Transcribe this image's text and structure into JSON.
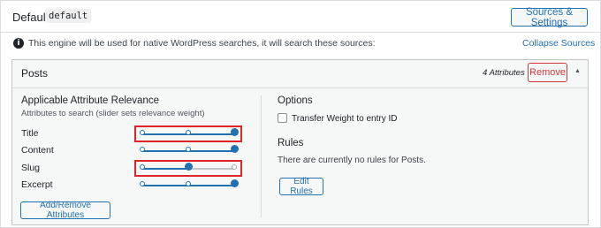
{
  "engine": {
    "title": "Default",
    "slug": "default",
    "sources_button": "Sources & Settings"
  },
  "notice": {
    "icon": "info-icon",
    "icon_glyph": "i",
    "text": "This engine will be used for native WordPress searches, it will search these sources:",
    "collapse_link": "Collapse Sources"
  },
  "source": {
    "title": "Posts",
    "attribute_count": "4 Attributes",
    "remove_button": "Remove",
    "caret_glyph": "▲",
    "left": {
      "heading": "Applicable Attribute Relevance",
      "subheading": "Attributes to search (slider sets relevance weight)",
      "attributes": [
        {
          "label": "Title",
          "weight": 1.0
        },
        {
          "label": "Content",
          "weight": 1.0
        },
        {
          "label": "Slug",
          "weight": 0.5
        },
        {
          "label": "Excerpt",
          "weight": 1.0
        }
      ],
      "add_remove_button": "Add/Remove Attributes"
    },
    "right": {
      "options_heading": "Options",
      "transfer_weight_label": "Transfer Weight to entry ID",
      "transfer_weight_checked": false,
      "rules_heading": "Rules",
      "rules_text": "There are currently no rules for Posts.",
      "edit_rules_button": "Edit Rules"
    }
  },
  "colors": {
    "accent": "#2271b1",
    "remove": "#d63638",
    "highlight": "#e0232a",
    "track_inactive": "#c3c4c7"
  }
}
